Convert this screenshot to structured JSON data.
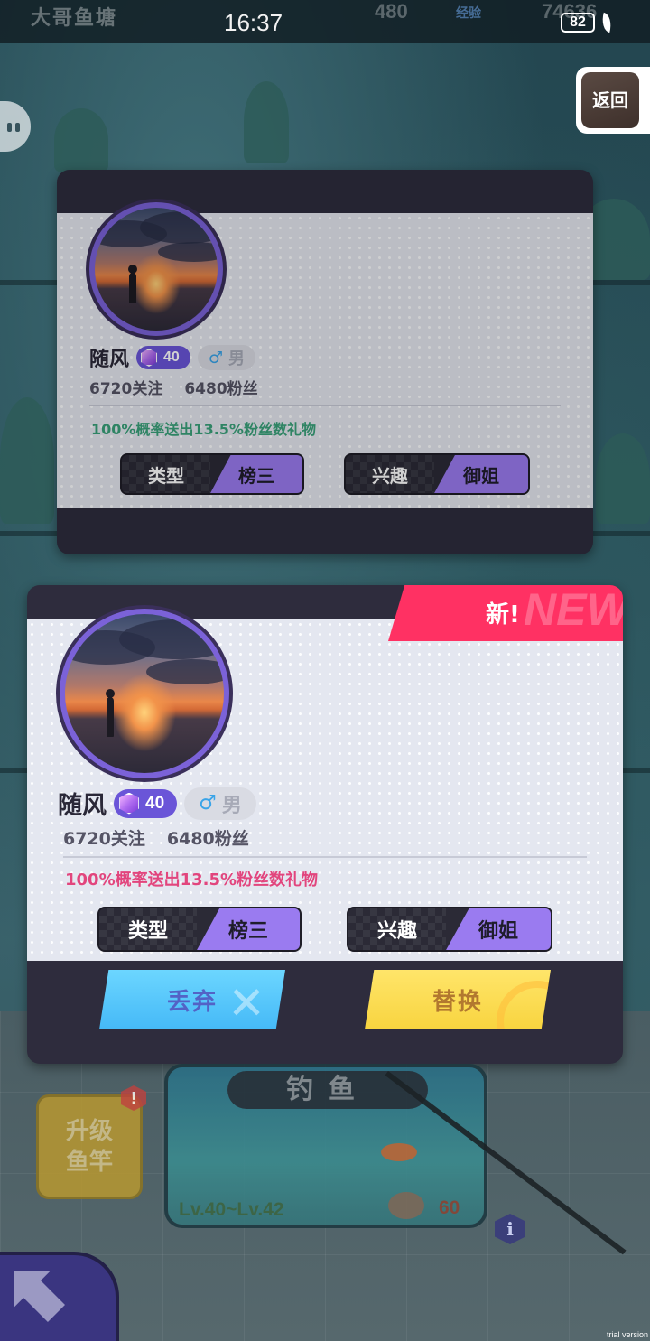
{
  "status_bar": {
    "pond_title": "大哥鱼塘",
    "time": "16:37",
    "counter_a": "480",
    "tag": "经验",
    "counter_b": "74636",
    "battery": "82"
  },
  "back_button": {
    "label": "返回"
  },
  "current_card": {
    "name": "随风",
    "level": "40",
    "gender_symbol": "♂",
    "gender": "男",
    "following": "6720关注",
    "fans": "6480粉丝",
    "gift_text": "100%概率送出13.5%粉丝数礼物",
    "type_label": "类型",
    "type_value": "榜三",
    "interest_label": "兴趣",
    "interest_value": "御姐"
  },
  "new_card": {
    "ribbon_label": "新!",
    "ribbon_ghost": "NEW",
    "name": "随风",
    "level": "40",
    "gender_symbol": "♂",
    "gender": "男",
    "following": "6720关注",
    "fans": "6480粉丝",
    "gift_text": "100%概率送出13.5%粉丝数礼物",
    "type_label": "类型",
    "type_value": "榜三",
    "interest_label": "兴趣",
    "interest_value": "御姐",
    "discard_label": "丢弃",
    "replace_label": "替换"
  },
  "game_controls": {
    "upgrade_label": "升级鱼竿",
    "alert_badge": "!",
    "fish_title": "钓鱼",
    "level_range": "Lv.40~Lv.42",
    "cost": "60",
    "info_icon": "i"
  },
  "colors": {
    "card_frame": "#2e2c3d",
    "level_badge": "#6a55d8",
    "tag_accent": "#9a7bf0",
    "gift_old": "#3aa27a",
    "gift_new": "#e2457d",
    "new_ribbon": "#ff3163",
    "discard_button": "#45b9f7",
    "replace_button": "#f8d43f"
  },
  "watermark": "trial version"
}
